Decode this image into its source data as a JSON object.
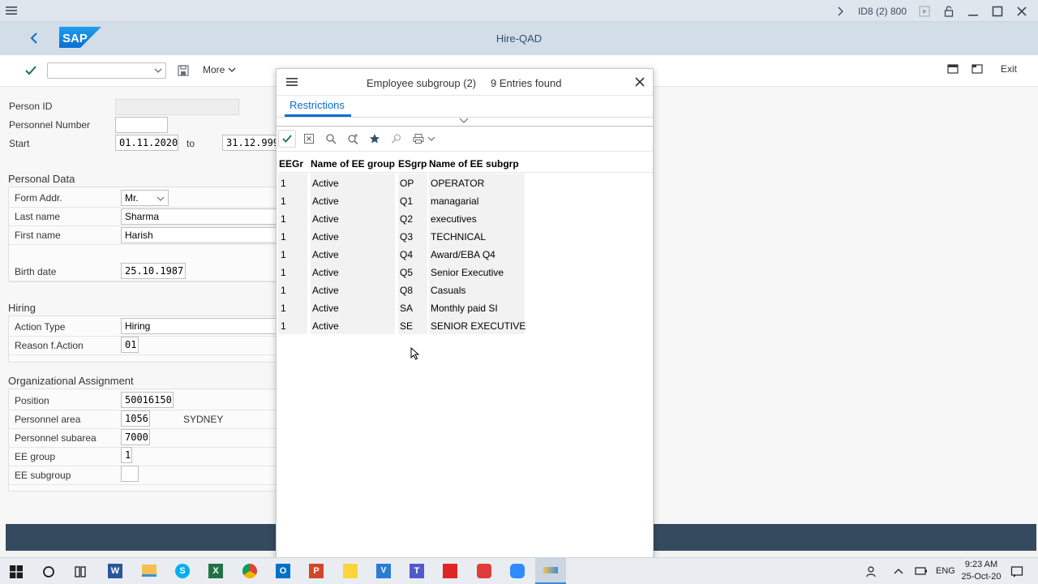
{
  "window": {
    "system_label": "ID8 (2) 800",
    "title": "Hire-QAD"
  },
  "toolbar": {
    "more_label": "More",
    "exit_label": "Exit",
    "command_value": ""
  },
  "form": {
    "person_id_label": "Person ID",
    "person_id_value": "",
    "personnel_number_label": "Personnel Number",
    "personnel_number_value": "",
    "start_label": "Start",
    "start_value": "01.11.2020",
    "to_label": "to",
    "end_value": "31.12.999",
    "personal_data": {
      "title": "Personal Data",
      "form_addr_label": "Form Addr.",
      "form_addr_value": "Mr.",
      "last_name_label": "Last name",
      "last_name_value": "Sharma",
      "first_name_label": "First name",
      "first_name_value": "Harish",
      "birth_date_label": "Birth date",
      "birth_date_value": "25.10.1987"
    },
    "hiring": {
      "title": "Hiring",
      "action_type_label": "Action Type",
      "action_type_value": "Hiring",
      "reason_label": "Reason f.Action",
      "reason_value": "01"
    },
    "org": {
      "title": "Organizational Assignment",
      "position_label": "Position",
      "position_value": "50016150",
      "personnel_area_label": "Personnel area",
      "personnel_area_value": "1056",
      "personnel_area_text": "SYDNEY",
      "personnel_subarea_label": "Personnel subarea",
      "personnel_subarea_value": "7000",
      "ee_group_label": "EE group",
      "ee_group_value": "1",
      "ee_subgroup_label": "EE subgroup",
      "ee_subgroup_value": ""
    }
  },
  "dialog": {
    "title": "Employee subgroup (2)",
    "count": "9 Entries found",
    "tab_restrictions": "Restrictions",
    "columns": [
      "EEGr",
      "Name of EE group",
      "ESgrp",
      "Name of EE subgrp"
    ],
    "rows": [
      {
        "eegr": "1",
        "group": "Active",
        "esgrp": "OP",
        "subgrp": "OPERATOR"
      },
      {
        "eegr": "1",
        "group": "Active",
        "esgrp": "Q1",
        "subgrp": "managarial"
      },
      {
        "eegr": "1",
        "group": "Active",
        "esgrp": "Q2",
        "subgrp": "executives"
      },
      {
        "eegr": "1",
        "group": "Active",
        "esgrp": "Q3",
        "subgrp": "TECHNICAL"
      },
      {
        "eegr": "1",
        "group": "Active",
        "esgrp": "Q4",
        "subgrp": "Award/EBA Q4"
      },
      {
        "eegr": "1",
        "group": "Active",
        "esgrp": "Q5",
        "subgrp": "Senior Executive"
      },
      {
        "eegr": "1",
        "group": "Active",
        "esgrp": "Q8",
        "subgrp": "Casuals"
      },
      {
        "eegr": "1",
        "group": "Active",
        "esgrp": "SA",
        "subgrp": "Monthly paid SI"
      },
      {
        "eegr": "1",
        "group": "Active",
        "esgrp": "SE",
        "subgrp": "SENIOR EXECUTIVE"
      }
    ]
  },
  "taskbar": {
    "language": "ENG",
    "time": "9:23 AM",
    "date": "25-Oct-20"
  },
  "colors": {
    "shell": "#d3dde8",
    "accent": "#0a6ed1",
    "footer": "#354a5f"
  }
}
